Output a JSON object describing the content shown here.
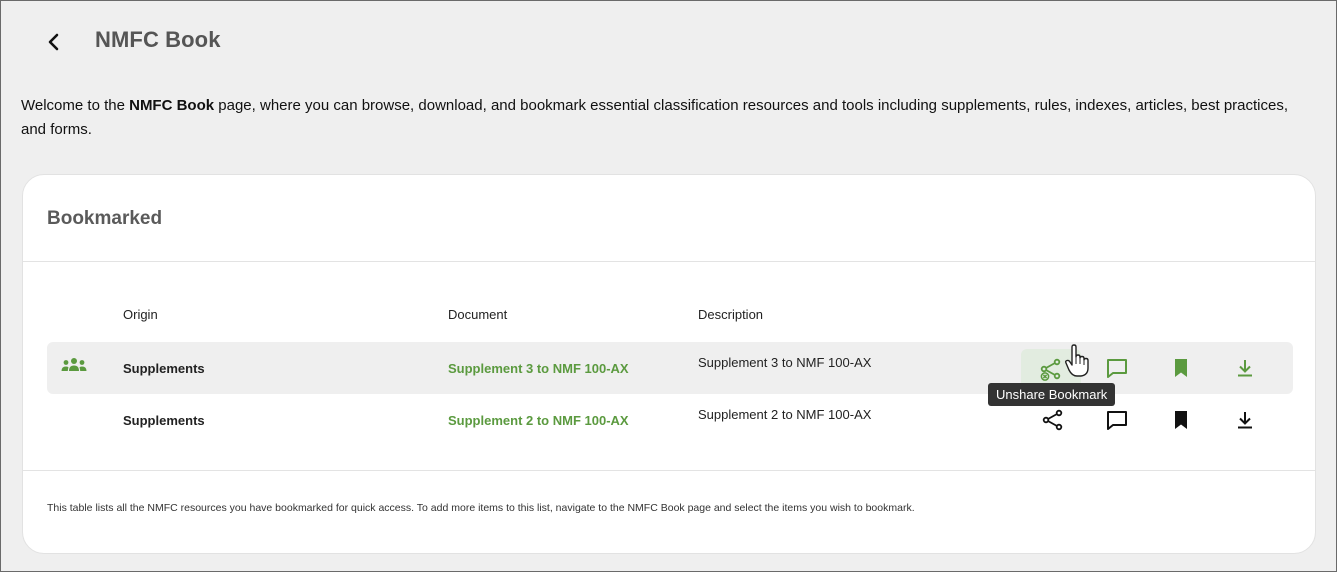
{
  "header": {
    "title": "NMFC Book"
  },
  "intro": {
    "prefix": "Welcome to the ",
    "bold": "NMFC Book",
    "suffix": " page, where you can browse, download, and bookmark essential classification resources and tools including supplements, rules, indexes, articles, best practices, and forms."
  },
  "bookmarked": {
    "title": "Bookmarked",
    "columns": {
      "origin": "Origin",
      "document": "Document",
      "description": "Description"
    },
    "rows": [
      {
        "origin": "Supplements",
        "document": "Supplement 3 to NMF 100-AX",
        "description": "Supplement 3 to NMF 100-AX",
        "shared": true
      },
      {
        "origin": "Supplements",
        "document": "Supplement 2 to NMF 100-AX",
        "description": "Supplement 2 to NMF 100-AX",
        "shared": false
      }
    ],
    "tooltip": "Unshare Bookmark",
    "footer": "This table lists all the NMFC resources you have bookmarked for quick access. To add more items to this list, navigate to the NMFC Book page and select the items you wish to bookmark."
  },
  "icons": {
    "back": "chevron-left-icon",
    "shared": "group-icon",
    "unshare": "unshare-icon",
    "share": "share-icon",
    "comment": "comment-icon",
    "bookmark": "bookmark-icon",
    "download": "download-icon"
  },
  "colors": {
    "accent": "#5b9a3f",
    "background": "#efefef",
    "card": "#ffffff",
    "tooltip": "#333333"
  }
}
